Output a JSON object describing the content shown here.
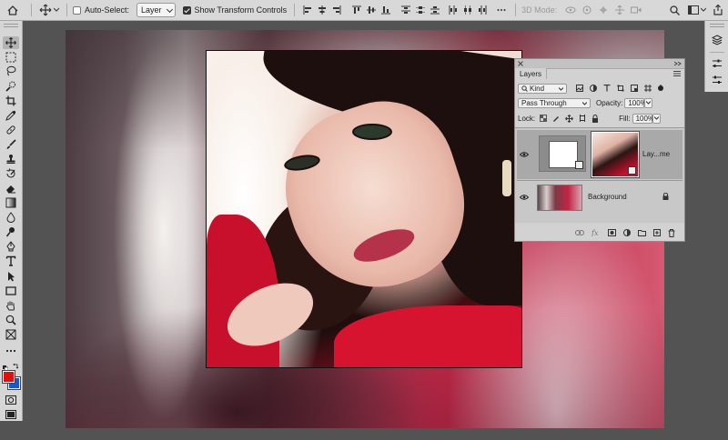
{
  "options_bar": {
    "auto_select_label": "Auto-Select:",
    "auto_select_checked": false,
    "auto_select_target": "Layer",
    "show_transform_label": "Show Transform Controls",
    "show_transform_checked": true,
    "mode_3d_label": "3D Mode:"
  },
  "colors": {
    "foreground": "#e01010",
    "background": "#1a56d8",
    "ui_light": "#d6d6d6",
    "workspace": "#535353"
  },
  "toolbar": {
    "tools": [
      "move-icon",
      "marquee-icon",
      "lasso-icon",
      "quick-select-icon",
      "crop-icon",
      "eyedropper-icon",
      "healing-icon",
      "brush-icon",
      "stamp-icon",
      "history-brush-icon",
      "eraser-icon",
      "gradient-icon",
      "blur-icon",
      "dodge-icon",
      "pen-icon",
      "type-icon",
      "path-select-icon",
      "rectangle-icon",
      "hand-icon",
      "zoom-icon",
      "frame-icon",
      "more-icon"
    ],
    "active_tool": "move-icon"
  },
  "layers_panel": {
    "tab_label": "Layers",
    "filter_kind": "Kind",
    "blend_mode": "Pass Through",
    "opacity_label": "Opacity:",
    "opacity_value": "100%",
    "lock_label": "Lock:",
    "fill_label": "Fill:",
    "fill_value": "100%",
    "layers": [
      {
        "name": "Lay...me",
        "visible": true,
        "selected": true
      },
      {
        "name": "Background",
        "visible": true,
        "selected": false,
        "locked": true
      }
    ]
  }
}
